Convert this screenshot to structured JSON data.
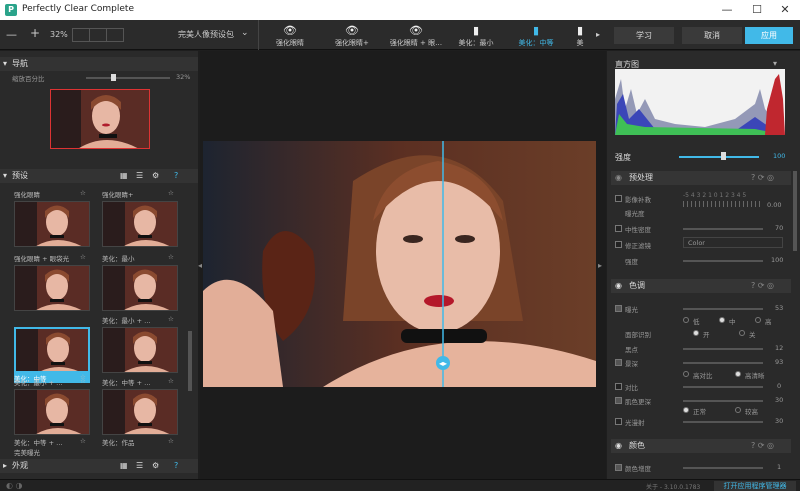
{
  "window": {
    "title": "Perfectly Clear Complete",
    "minimize": "—",
    "maximize": "☐",
    "close": "✕"
  },
  "toolbar": {
    "zoom_out": "—",
    "zoom_in": "+",
    "zoom": "32%",
    "preset_set": "完美人像预设包",
    "presets": [
      {
        "label": "强化眼睛",
        "icon": "eye-icon"
      },
      {
        "label": "强化眼睛+",
        "icon": "eye-icon"
      },
      {
        "label": "强化眼睛 + 眼…",
        "icon": "eye-icon"
      },
      {
        "label": "美化：最小",
        "icon": "lipstick-icon"
      },
      {
        "label": "美化：中等",
        "icon": "lipstick-icon"
      },
      {
        "label": "美",
        "icon": "lipstick-icon"
      }
    ],
    "learn": "学习",
    "cancel": "取消",
    "apply": "应用"
  },
  "nav": {
    "title": "导航",
    "zoom_label": "缩放百分比",
    "zoom_value": "32%",
    "zoom_fraction": 0.32
  },
  "presets_panel": {
    "title": "预设",
    "thumbs": [
      {
        "label": "强化眼睛"
      },
      {
        "label": "强化眼睛+"
      },
      {
        "label": "强化眼睛 + 眼袋光"
      },
      {
        "label": "美化：最小"
      },
      {
        "label": "美化：中等"
      },
      {
        "label": "美化：最小 + …"
      },
      {
        "label": "美化：最小 + …"
      },
      {
        "label": "美化：中等 + …"
      },
      {
        "label": "美化：中等 + …"
      },
      {
        "label": "美化：作品"
      }
    ],
    "footer": "完美曝光",
    "exterior": "外观"
  },
  "right": {
    "histogram_title": "直方图",
    "strength_label": "强度",
    "strength_value": "100",
    "strength_fraction": 0.55,
    "pre": {
      "title": "预处理",
      "rows": [
        {
          "label": "影像补救",
          "value": "0.00"
        },
        {
          "label": "曝光度",
          "value": ""
        },
        {
          "label": "中性密度",
          "value": "70"
        },
        {
          "label": "修正滤镜",
          "value": "Color"
        },
        {
          "label": "强度",
          "value": "100"
        }
      ],
      "scale": "-5 4 3 2 1 0 1 2 3 4 5"
    },
    "tone": {
      "title": "色调",
      "exposure": "曝光",
      "exposure_value": "53",
      "low": "低",
      "mid": "中",
      "high": "高",
      "face_detect": "面部识别",
      "on": "开",
      "off": "关",
      "black": "黑点",
      "black_value": "12",
      "depth": "景深",
      "depth_value": "93",
      "depth_a": "高对比",
      "depth_b": "高清晰",
      "contrast": "对比",
      "contrast_value": "0",
      "skin": "肌色更深",
      "skin_value": "30",
      "normal": "正常",
      "weak": "较高",
      "light": "光漫射",
      "light_value": "30"
    },
    "color": {
      "title": "颜色",
      "vivid": "颜色增度",
      "vivid_value": "1"
    }
  },
  "status": {
    "version": "关于 - 3.10.0.1783",
    "manager": "打开应用程序管理器"
  }
}
